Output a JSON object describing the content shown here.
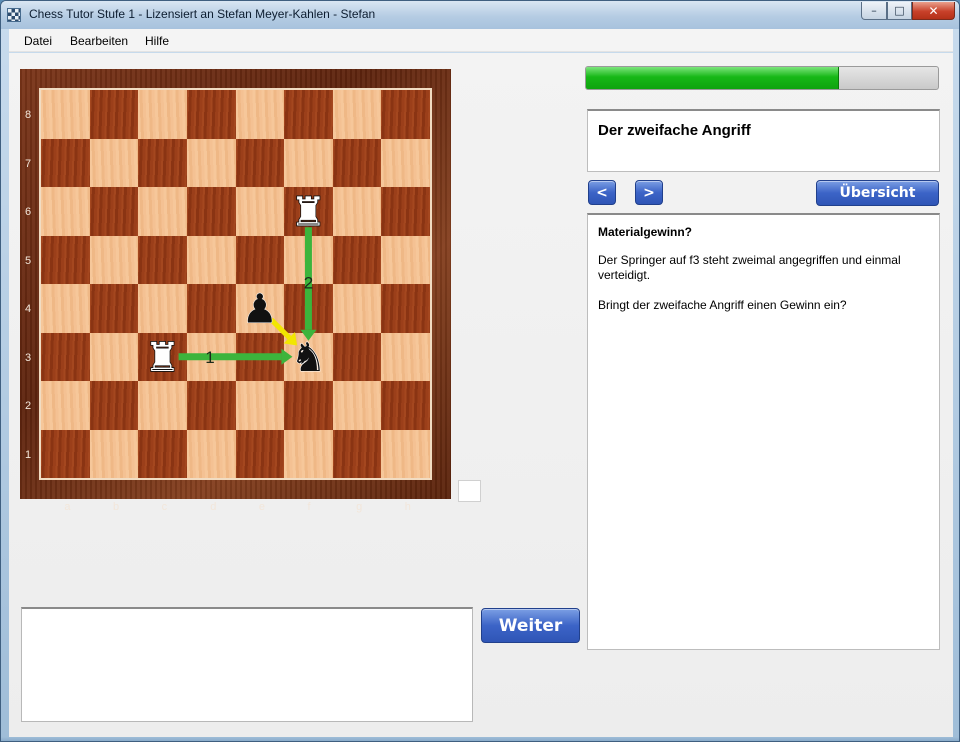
{
  "window": {
    "title": "Chess Tutor Stufe 1 - Lizensiert an Stefan Meyer-Kahlen - Stefan",
    "controls": {
      "minimize": "–",
      "maximize": "□",
      "close": "✕"
    }
  },
  "menu": {
    "items": [
      "Datei",
      "Bearbeiten",
      "Hilfe"
    ]
  },
  "board": {
    "files": [
      "a",
      "b",
      "c",
      "d",
      "e",
      "f",
      "g",
      "h"
    ],
    "ranks": [
      "8",
      "7",
      "6",
      "5",
      "4",
      "3",
      "2",
      "1"
    ],
    "light_color": "#f4c193",
    "dark_color": "#9b3f1a",
    "pieces": [
      {
        "square": "f6",
        "piece": "rook",
        "color": "white",
        "glyph": "♜"
      },
      {
        "square": "e4",
        "piece": "pawn",
        "color": "black",
        "glyph": "♟"
      },
      {
        "square": "c3",
        "piece": "rook",
        "color": "white",
        "glyph": "♜"
      },
      {
        "square": "f3",
        "piece": "knight",
        "color": "black",
        "glyph": "♞"
      }
    ],
    "arrows": [
      {
        "from": "c3",
        "to": "f3",
        "color": "#3cb43c",
        "label": "1"
      },
      {
        "from": "f6",
        "to": "f3",
        "color": "#3cb43c",
        "label": "2"
      },
      {
        "from": "e4",
        "to": "f3",
        "color": "#f2e600",
        "label": ""
      }
    ]
  },
  "progress": {
    "fraction": 0.72,
    "color": "#17b817"
  },
  "lesson": {
    "title": "Der zweifache Angriff"
  },
  "nav": {
    "prev_label": "<",
    "next_label": ">",
    "overview_label": "Übersicht"
  },
  "text": {
    "heading": "Materialgewinn?",
    "paragraphs": [
      "Der Springer auf f3 steht zweimal angegriffen und einmal verteidigt.",
      "Bringt der zweifache Angriff einen Gewinn ein?"
    ]
  },
  "actions": {
    "next_label": "Weiter"
  },
  "accent_color": "#3c64c7"
}
